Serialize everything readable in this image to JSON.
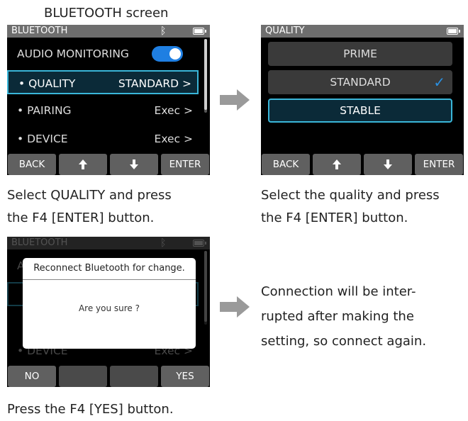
{
  "panel1": {
    "screen_label": "BLUETOOTH screen",
    "topbar_title": "BLUETOOTH",
    "bt_symbol": "✱",
    "rows": [
      {
        "label": "AUDIO MONITORING",
        "value": ""
      },
      {
        "label": "• QUALITY",
        "value": "STANDARD >"
      },
      {
        "label": "• PAIRING",
        "value": "Exec >"
      },
      {
        "label": "• DEVICE",
        "value": "Exec >"
      }
    ],
    "fkeys": [
      "BACK",
      "🡅",
      "🡇",
      "ENTER"
    ],
    "caption": [
      "Select QUALITY and press",
      "the F4 [ENTER] button."
    ]
  },
  "panel2": {
    "topbar_title": "QUALITY",
    "options": [
      "PRIME",
      "STANDARD",
      "STABLE"
    ],
    "checked": "STANDARD",
    "fkeys": [
      "BACK",
      "🡅",
      "🡇",
      "ENTER"
    ],
    "caption": [
      "Select the quality and press",
      "the F4 [ENTER] button."
    ]
  },
  "panel3": {
    "topbar_title": "BLUETOOTH",
    "bt_symbol": "✱",
    "bg_rows": [
      {
        "label": "A",
        "value": ""
      },
      {
        "label": "• DEVICE",
        "value": "Exec >"
      }
    ],
    "dialog_title": "Reconnect Bluetooth for change.",
    "dialog_message": "Are you sure ?",
    "fkeys": [
      "NO",
      "",
      "",
      "YES"
    ],
    "caption": "Press the F4 [YES] button."
  },
  "side_note": [
    "Connection will be inter-",
    "rupted after making the",
    "setting, so connect again."
  ],
  "colors": {
    "highlight": "#3ab6d9",
    "toggle": "#1f7fe2",
    "check": "#2a8fe0"
  }
}
